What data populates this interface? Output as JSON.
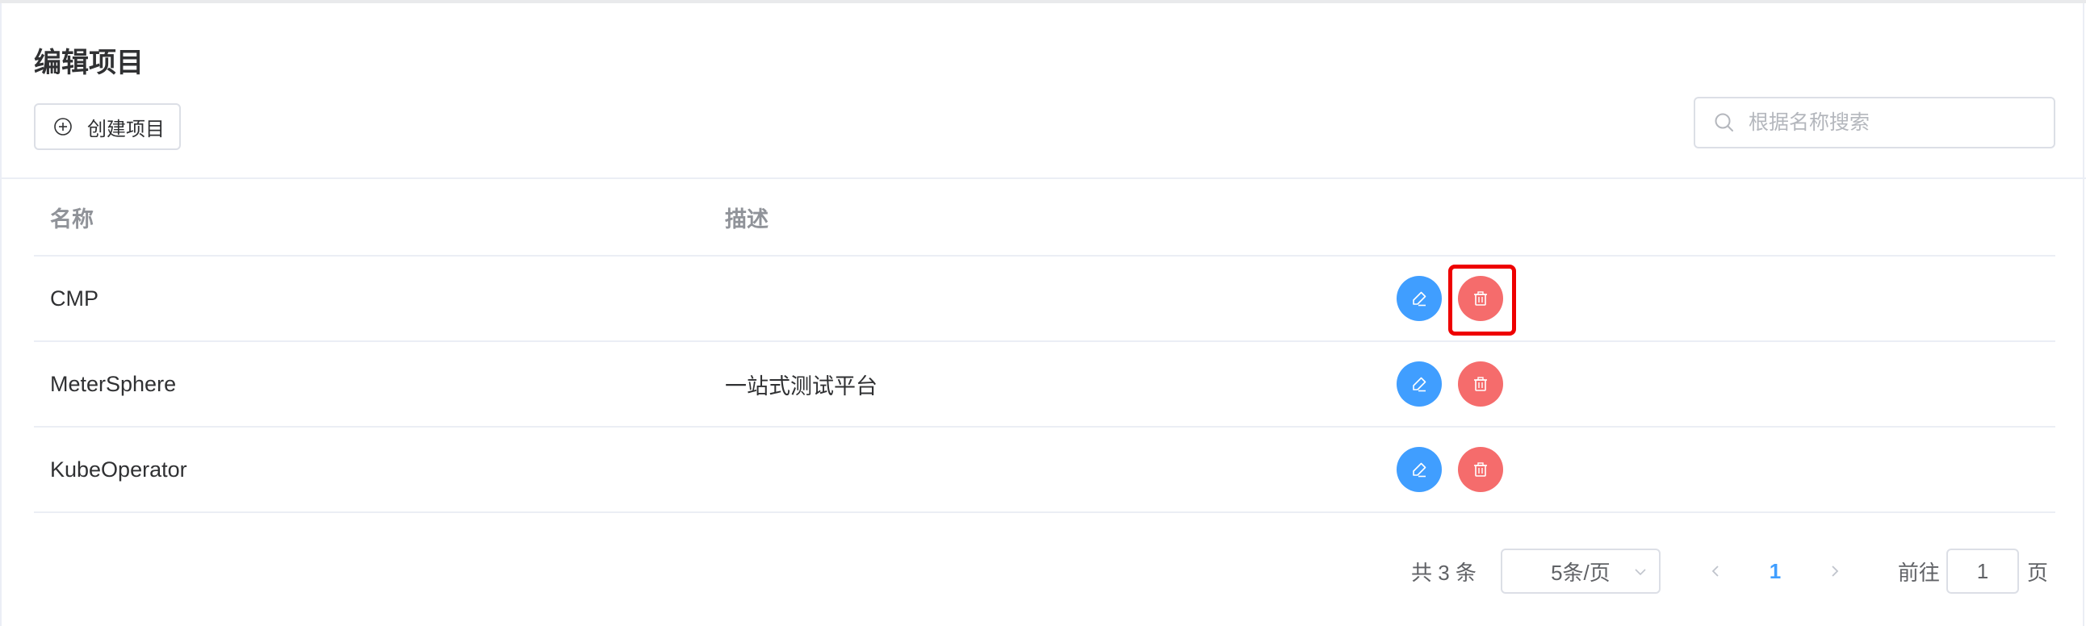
{
  "page": {
    "title": "编辑项目",
    "create_button_label": "创建项目",
    "search": {
      "placeholder": "根据名称搜索",
      "value": ""
    }
  },
  "table": {
    "columns": [
      "名称",
      "描述",
      ""
    ],
    "rows": [
      {
        "name": "CMP",
        "description": ""
      },
      {
        "name": "MeterSphere",
        "description": "一站式测试平台"
      },
      {
        "name": "KubeOperator",
        "description": ""
      }
    ]
  },
  "pagination": {
    "total_text": "共 3 条",
    "page_size_text": "5条/页",
    "current_page": "1",
    "goto_label": "前往",
    "goto_value": "1",
    "page_unit": "页"
  },
  "colors": {
    "edit_button": "#409eff",
    "delete_button": "#f56c6c",
    "highlight_box": "#ee0000"
  },
  "icons": {
    "create": "plus-circle-icon",
    "search": "search-icon",
    "edit": "edit-icon",
    "delete": "trash-icon"
  }
}
